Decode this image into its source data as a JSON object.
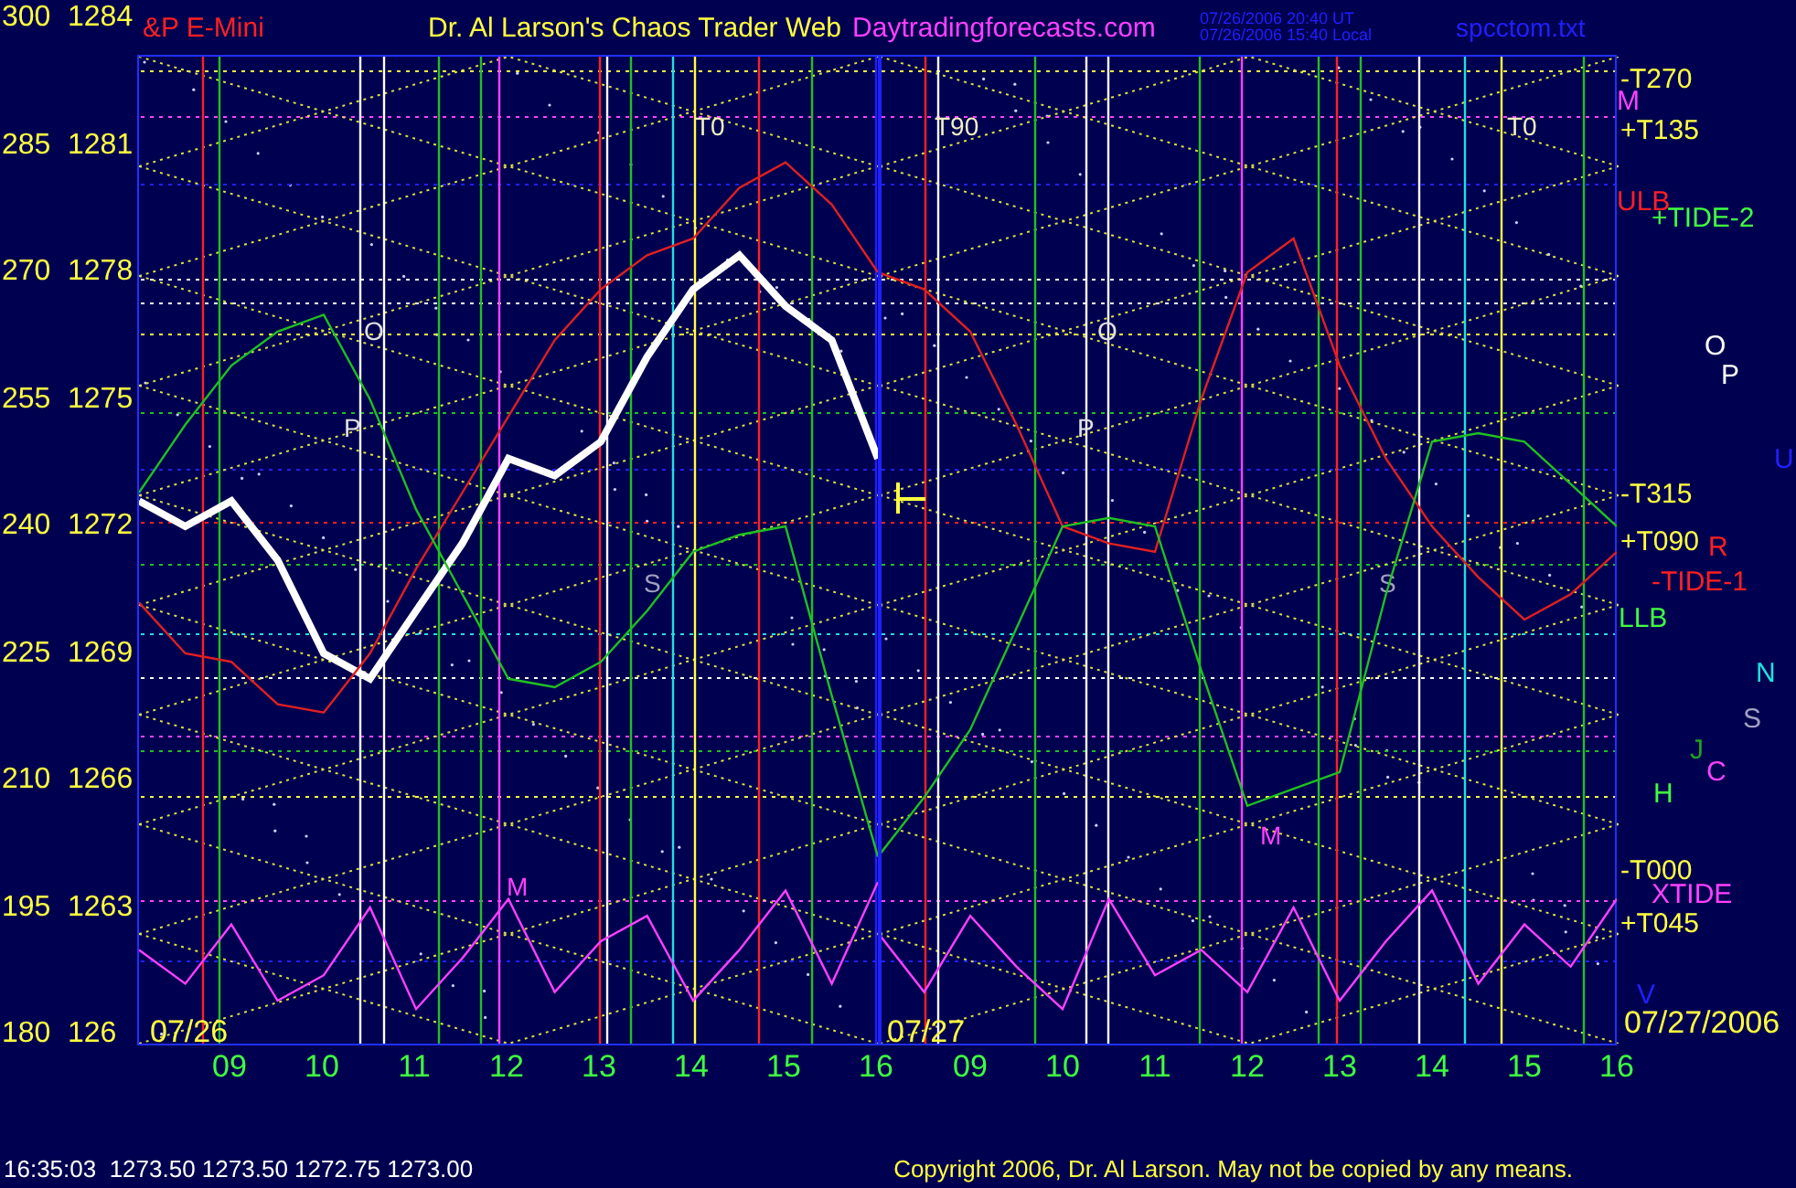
{
  "header": {
    "instrument": "&P E-Mini",
    "title": "Dr. Al Larson's Chaos Trader Web",
    "site": "Daytradingforecasts.com",
    "times": [
      "07/26/2006 20:40 UT",
      "07/26/2006 15:40 Local"
    ],
    "file": "spcctom.txt"
  },
  "y_prices": [
    "1284",
    "1281",
    "1278",
    "1275",
    "1272",
    "1269",
    "1266",
    "1263",
    "126"
  ],
  "plot": {
    "days": [
      {
        "chart_data": {
          "type": "line",
          "xlim": [
            8,
            16
          ],
          "ylim": [
            180,
            300
          ],
          "x": [
            8,
            8.5,
            9,
            9.5,
            10,
            10.5,
            11,
            11.5,
            12,
            12.5,
            13,
            13.5,
            14,
            14.5,
            15,
            15.5,
            16
          ],
          "xticks": [
            {
              "value": 9,
              "label": "09"
            },
            {
              "value": 10,
              "label": "10"
            },
            {
              "value": 11,
              "label": "11"
            },
            {
              "value": 12,
              "label": "12"
            },
            {
              "value": 13,
              "label": "13"
            },
            {
              "value": 14,
              "label": "14"
            },
            {
              "value": 15,
              "label": "15"
            },
            {
              "value": 16,
              "label": "16"
            }
          ],
          "yticks": [
            {
              "value": 300,
              "label": "300"
            },
            {
              "value": 285,
              "label": "285"
            },
            {
              "value": 270,
              "label": "270"
            },
            {
              "value": 255,
              "label": "255"
            },
            {
              "value": 240,
              "label": "240"
            },
            {
              "value": 225,
              "label": "225"
            },
            {
              "value": 210,
              "label": "210"
            },
            {
              "value": 195,
              "label": "195"
            },
            {
              "value": 180,
              "label": "180"
            }
          ],
          "series": [
            {
              "color": "#ffffff",
              "values": [
                243,
                240,
                243,
                236,
                225,
                222,
                230,
                238,
                248,
                246,
                250,
                260,
                268,
                272,
                266,
                262,
                248
              ]
            },
            {
              "color": "#e02020",
              "values": [
                231,
                225,
                224,
                219,
                218,
                225,
                235,
                244,
                253,
                262,
                268,
                272,
                274,
                280,
                283,
                278,
                270
              ]
            },
            {
              "color": "#20c020",
              "values": [
                244,
                252,
                259,
                263,
                265,
                255,
                242,
                232,
                222,
                221,
                224,
                230,
                237,
                239,
                240,
                220,
                201
              ]
            },
            {
              "color": "#ff40ff",
              "values": [
                190,
                186,
                193,
                184,
                187,
                195,
                183,
                189,
                196,
                185,
                191,
                194,
                184,
                190,
                197,
                186,
                198
              ]
            }
          ]
        }
      },
      {
        "chart_data": {
          "type": "line",
          "xlim": [
            8,
            16
          ],
          "ylim": [
            180,
            300
          ],
          "x": [
            8,
            8.5,
            9,
            9.5,
            10,
            10.5,
            11,
            11.5,
            12,
            12.5,
            13,
            13.5,
            14,
            14.5,
            15,
            15.5,
            16
          ],
          "xticks": [
            {
              "value": 9,
              "label": "09"
            },
            {
              "value": 10,
              "label": "10"
            },
            {
              "value": 11,
              "label": "11"
            },
            {
              "value": 12,
              "label": "12"
            },
            {
              "value": 13,
              "label": "13"
            },
            {
              "value": 14,
              "label": "14"
            },
            {
              "value": 15,
              "label": "15"
            },
            {
              "value": 16,
              "label": "16"
            }
          ],
          "series": [
            {
              "color": "#e02020",
              "values": [
                270,
                268,
                263,
                252,
                240,
                238,
                237,
                255,
                270,
                274,
                259,
                248,
                240,
                234,
                229,
                232,
                237
              ]
            },
            {
              "color": "#20c020",
              "values": [
                201,
                208,
                216,
                228,
                240,
                241,
                240,
                223,
                207,
                209,
                211,
                232,
                250,
                251,
                250,
                245,
                240
              ]
            },
            {
              "color": "#ff40ff",
              "values": [
                192,
                185,
                194,
                188,
                183,
                196,
                187,
                190,
                185,
                195,
                184,
                191,
                197,
                186,
                193,
                188,
                196
              ]
            }
          ]
        }
      }
    ]
  },
  "chart_markers": [
    {
      "text": "T0",
      "color": "#f0f0c0"
    },
    {
      "text": "T90",
      "color": "#f0f0c0"
    },
    {
      "text": "T0",
      "color": "#f0f0c0"
    },
    {
      "text": "O",
      "color": "#e0e0e0"
    },
    {
      "text": "P",
      "color": "#e0e0e0"
    },
    {
      "text": "O",
      "color": "#e0e0e0"
    },
    {
      "text": "P",
      "color": "#e0e0e0"
    },
    {
      "text": "S",
      "color": "#a0a0c0"
    },
    {
      "text": "S",
      "color": "#a0a0c0"
    },
    {
      "text": "M",
      "color": "#ff40ff"
    },
    {
      "text": "M",
      "color": "#ff40ff"
    },
    {
      "text": "07/26",
      "color": "#ffff40"
    },
    {
      "text": "07/27",
      "color": "#ffff40"
    }
  ],
  "right_labels": [
    {
      "text": "-T270",
      "color": "#ffff40"
    },
    {
      "text": "M",
      "color": "#ff40ff"
    },
    {
      "text": "+T135",
      "color": "#ffff40"
    },
    {
      "text": "ULB",
      "color": "#ff2020"
    },
    {
      "text": "+TIDE-2",
      "color": "#40ff40"
    },
    {
      "text": "O",
      "color": "#ffffff"
    },
    {
      "text": "P",
      "color": "#ffffff"
    },
    {
      "text": "U",
      "color": "#2020ff"
    },
    {
      "text": "-T315",
      "color": "#ffff40"
    },
    {
      "text": "+T090",
      "color": "#ffff40"
    },
    {
      "text": "R",
      "color": "#ff2020"
    },
    {
      "text": "-TIDE-1",
      "color": "#ff2020"
    },
    {
      "text": "LLB",
      "color": "#40ff40"
    },
    {
      "text": "N",
      "color": "#20e0e0"
    },
    {
      "text": "S",
      "color": "#a0a0c0"
    },
    {
      "text": "J",
      "color": "#20a020"
    },
    {
      "text": "C",
      "color": "#ff40ff"
    },
    {
      "text": "H",
      "color": "#40ff40"
    },
    {
      "text": "-T000",
      "color": "#ffff40"
    },
    {
      "text": "XTIDE",
      "color": "#ff40ff"
    },
    {
      "text": "+T045",
      "color": "#ffff40"
    },
    {
      "text": "V",
      "color": "#2020ff"
    },
    {
      "text": "07/27/2006",
      "color": "#ffff40"
    }
  ],
  "status": "16:35:03  1273.50 1273.50 1272.75 1273.00",
  "copyright": "Copyright 2006, Dr. Al Larson. May not be copied by any means."
}
